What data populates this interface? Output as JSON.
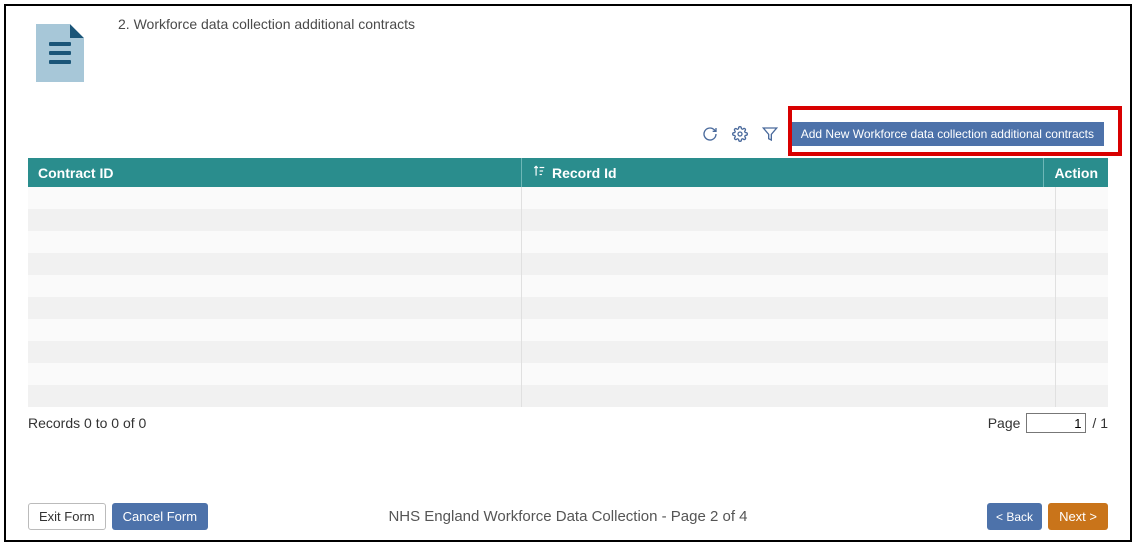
{
  "page_title": "2. Workforce data collection additional contracts",
  "toolbar": {
    "add_button_label": "Add New Workforce data collection additional contracts"
  },
  "table": {
    "columns": {
      "contract_id": "Contract ID",
      "record_id": "Record Id",
      "action": "Action"
    }
  },
  "footer": {
    "records_text": "Records 0 to 0 of 0",
    "page_label": "Page",
    "page_value": "1",
    "page_total_suffix": "/ 1"
  },
  "bottom": {
    "exit_form": "Exit Form",
    "cancel_form": "Cancel Form",
    "center_text": "NHS England Workforce Data Collection - Page 2 of 4",
    "back": "< Back",
    "next": "Next >"
  }
}
